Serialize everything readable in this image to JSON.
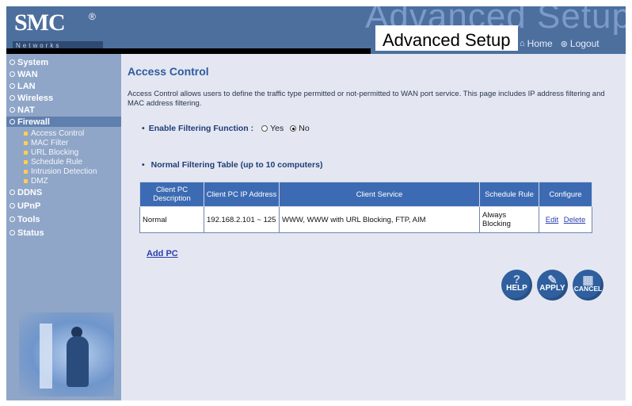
{
  "header": {
    "logo_text": "SMC",
    "logo_registered": "®",
    "logo_subtitle": "Networks",
    "background_title": "Advanced Setup",
    "title": "Advanced Setup",
    "home_label": "Home",
    "logout_label": "Logout"
  },
  "sidebar": {
    "items": [
      {
        "label": "System",
        "active": false
      },
      {
        "label": "WAN",
        "active": false
      },
      {
        "label": "LAN",
        "active": false
      },
      {
        "label": "Wireless",
        "active": false
      },
      {
        "label": "NAT",
        "active": false
      },
      {
        "label": "Firewall",
        "active": true
      }
    ],
    "firewall_subitems": [
      {
        "label": "Access Control"
      },
      {
        "label": "MAC Filter"
      },
      {
        "label": "URL Blocking"
      },
      {
        "label": "Schedule Rule"
      },
      {
        "label": "Intrusion Detection"
      },
      {
        "label": "DMZ"
      }
    ],
    "items_after": [
      {
        "label": "DDNS"
      },
      {
        "label": "UPnP"
      },
      {
        "label": "Tools"
      },
      {
        "label": "Status"
      }
    ]
  },
  "main": {
    "title": "Access Control",
    "description": "Access Control allows users to define the traffic type permitted or not-permitted to WAN port service. This page includes IP address filtering and MAC address filtering.",
    "filter_label": "Enable Filtering Function :",
    "filter_options": [
      {
        "label": "Yes",
        "selected": false
      },
      {
        "label": "No",
        "selected": true
      }
    ],
    "table_title": "Normal Filtering Table (up to 10 computers)",
    "table": {
      "headers": [
        "Client PC Description",
        "Client PC IP Address",
        "Client Service",
        "Schedule Rule",
        "Configure"
      ],
      "rows": [
        {
          "description": "Normal",
          "ip": "192.168.2.101 ~ 125",
          "service": "WWW,  WWW with URL Blocking,  FTP,  AIM",
          "schedule": "Always Blocking",
          "edit_label": "Edit",
          "delete_label": "Delete"
        }
      ]
    },
    "add_pc_label": "Add PC",
    "buttons": {
      "help": "HELP",
      "apply": "APPLY",
      "cancel": "CANCEL"
    }
  },
  "colors": {
    "header_bg": "#4c6f9e",
    "sidebar_bg": "#8fa6c8",
    "main_bg": "#e4e7f1",
    "title_blue": "#2f5aa0",
    "table_header": "#3d6bb3",
    "button_blue": "#2f5f9e",
    "submenu_bullet": "#ffd24a"
  }
}
